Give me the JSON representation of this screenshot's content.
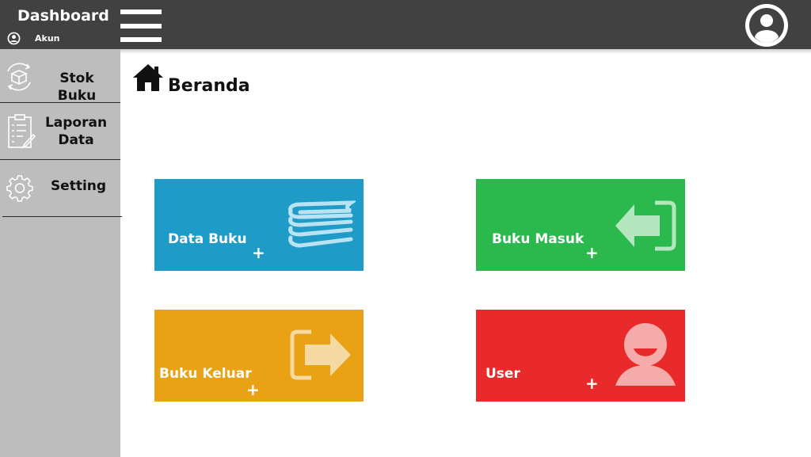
{
  "header": {
    "title": "Dashboard",
    "account_label": "Akun",
    "account_icon": "user-circle-icon",
    "menu_icon": "hamburger-icon",
    "avatar_icon": "avatar-icon"
  },
  "sidebar": {
    "items": [
      {
        "label": "Stok Buku",
        "icon": "box-cycle-icon"
      },
      {
        "label": "Laporan Data",
        "icon": "clipboard-icon"
      },
      {
        "label": "Setting",
        "icon": "gear-icon"
      }
    ]
  },
  "main": {
    "title": "Beranda",
    "title_icon": "home-icon",
    "tiles": [
      {
        "label": "Data Buku",
        "plus": "+",
        "icon": "books-icon",
        "color": "#1f9bc8"
      },
      {
        "label": "Buku Masuk",
        "plus": "+",
        "icon": "sign-in-arrow-icon",
        "color": "#2bb84c"
      },
      {
        "label": "Buku Keluar",
        "plus": "+",
        "icon": "sign-out-arrow-icon",
        "color": "#e8a214"
      },
      {
        "label": "User",
        "plus": "+",
        "icon": "user-icon",
        "color": "#e92a2a"
      }
    ]
  },
  "colors": {
    "topbar": "#414141",
    "sidebar": "#bdbdbd"
  }
}
